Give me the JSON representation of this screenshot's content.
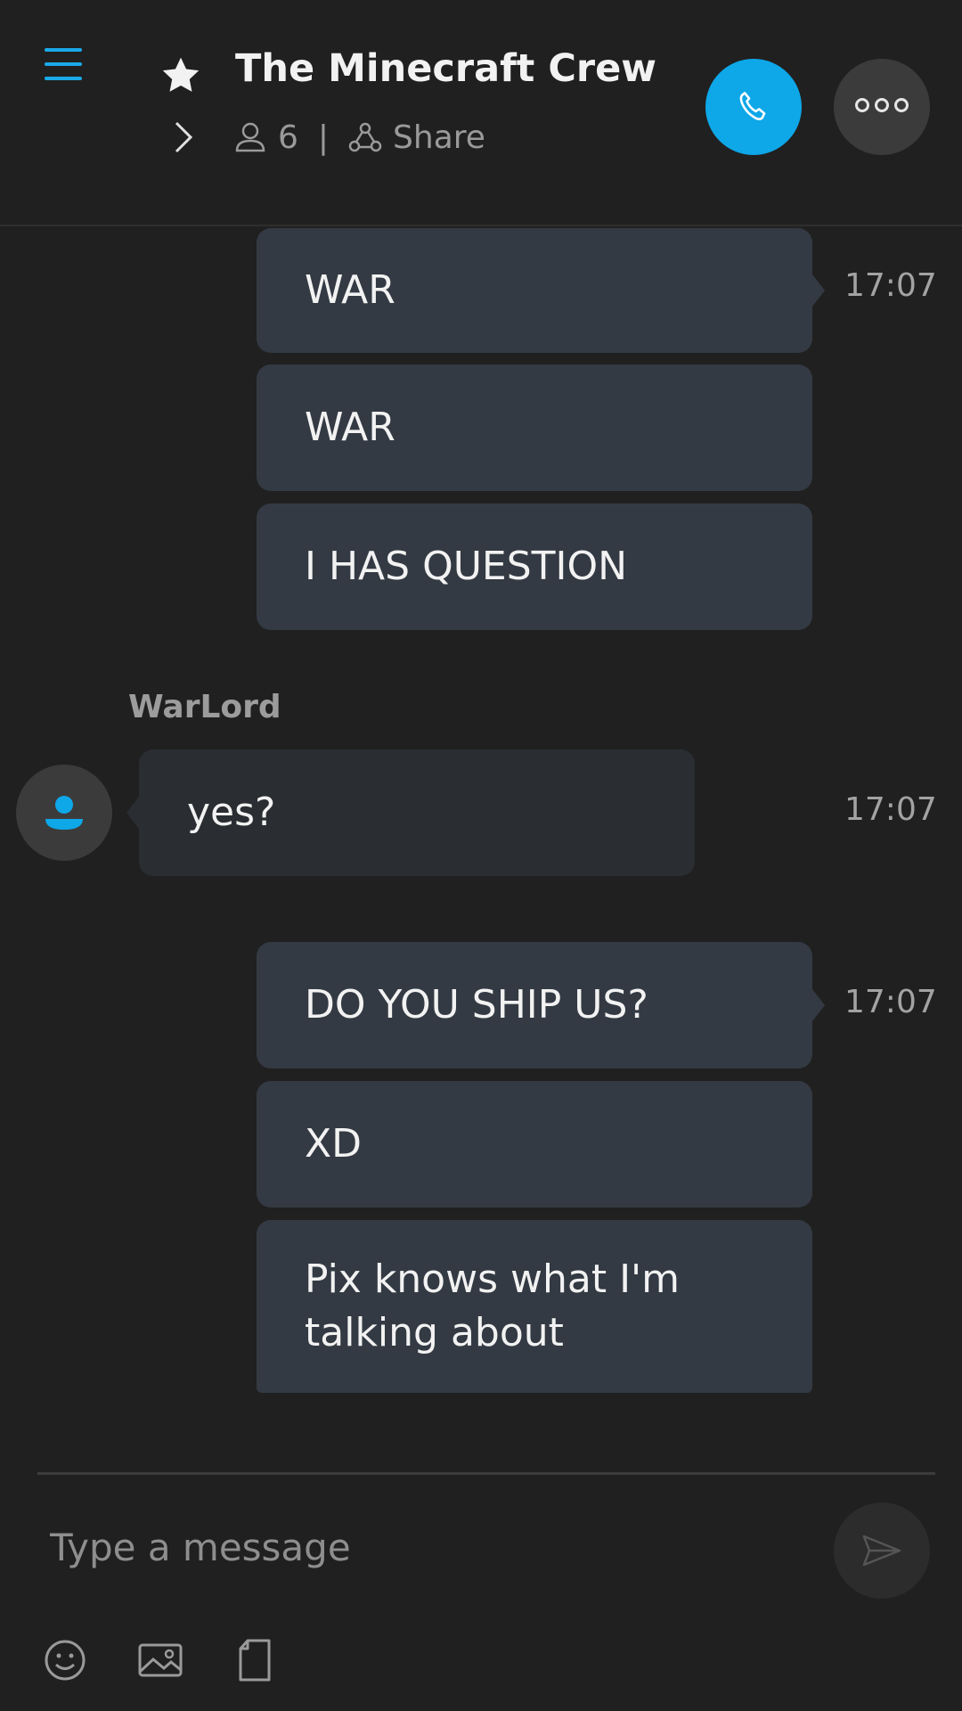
{
  "header": {
    "title": "The Minecraft Crew",
    "participants_count": "6",
    "separator": "|",
    "share_label": "Share",
    "accent_color": "#0ea7e8"
  },
  "icons": {
    "menu": "hamburger-menu-icon",
    "favorite": "star-icon",
    "expand": "chevron-right-icon",
    "participants": "person-icon",
    "share": "share-icon",
    "call": "phone-icon",
    "more": "more-dots-icon",
    "send": "send-icon",
    "emoji": "emoji-icon",
    "image": "image-icon",
    "file": "file-icon"
  },
  "messages": {
    "group1": {
      "time": "17:07",
      "items": [
        "WAR",
        "WAR",
        "I HAS QUESTION"
      ]
    },
    "incoming": {
      "sender": "WarLord",
      "text": "yes?",
      "time": "17:07"
    },
    "group2": {
      "time": "17:07",
      "items": [
        "DO YOU SHIP US?",
        "XD",
        "Pix knows what I'm talking about"
      ]
    }
  },
  "compose": {
    "placeholder": "Type a message"
  }
}
